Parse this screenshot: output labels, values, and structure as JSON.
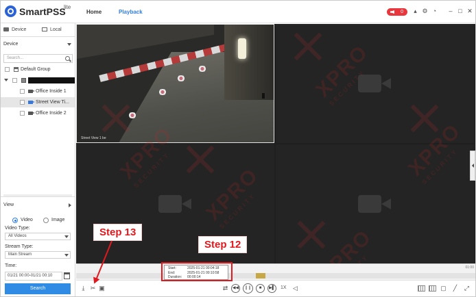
{
  "app": {
    "brand": "SmartPSS",
    "brand_suffix": "lite",
    "nav": {
      "home": "Home",
      "playback": "Playback"
    },
    "alarm_count": "0",
    "accent_color": "#2f7de1",
    "alarm_color": "#e8383d"
  },
  "sidebar": {
    "tabs": {
      "device": "Device",
      "local": "Local"
    },
    "device_dropdown": "Device",
    "search_placeholder": "Search...",
    "tree": {
      "group": "Default Group",
      "channels": [
        {
          "label": "Office Inside 1",
          "selected": false
        },
        {
          "label": "Street View Ti...",
          "selected": true
        },
        {
          "label": "Office Inside 2",
          "selected": false
        }
      ]
    },
    "view_label": "View",
    "record_type": {
      "video": "Video",
      "image": "Image",
      "selected": "Video"
    },
    "video_type_label": "Video Type:",
    "video_type_value": "All Videos",
    "stream_type_label": "Stream Type:",
    "stream_type_value": "Main Stream",
    "time_label": "Time:",
    "time_value": "01/21 00:00-01/21 00:10",
    "search_button": "Search"
  },
  "video": {
    "live_camera_label": "Street View 1 be",
    "watermark_big": "XPRO",
    "watermark_small": "SECURITY"
  },
  "timeline": {
    "end_label": "01:00"
  },
  "tooltip": {
    "start_label": "Start:",
    "start_value": "2025-01-21 00:04:18",
    "end_label": "End:",
    "end_value": "2025-01-21 00:10:58",
    "duration_label": "Duration:",
    "duration_value": "00:00:14"
  },
  "controls": {
    "speed": "1X"
  },
  "annotations": {
    "step13": "Step 13",
    "step12": "Step 12",
    "color": "#e0191e"
  }
}
